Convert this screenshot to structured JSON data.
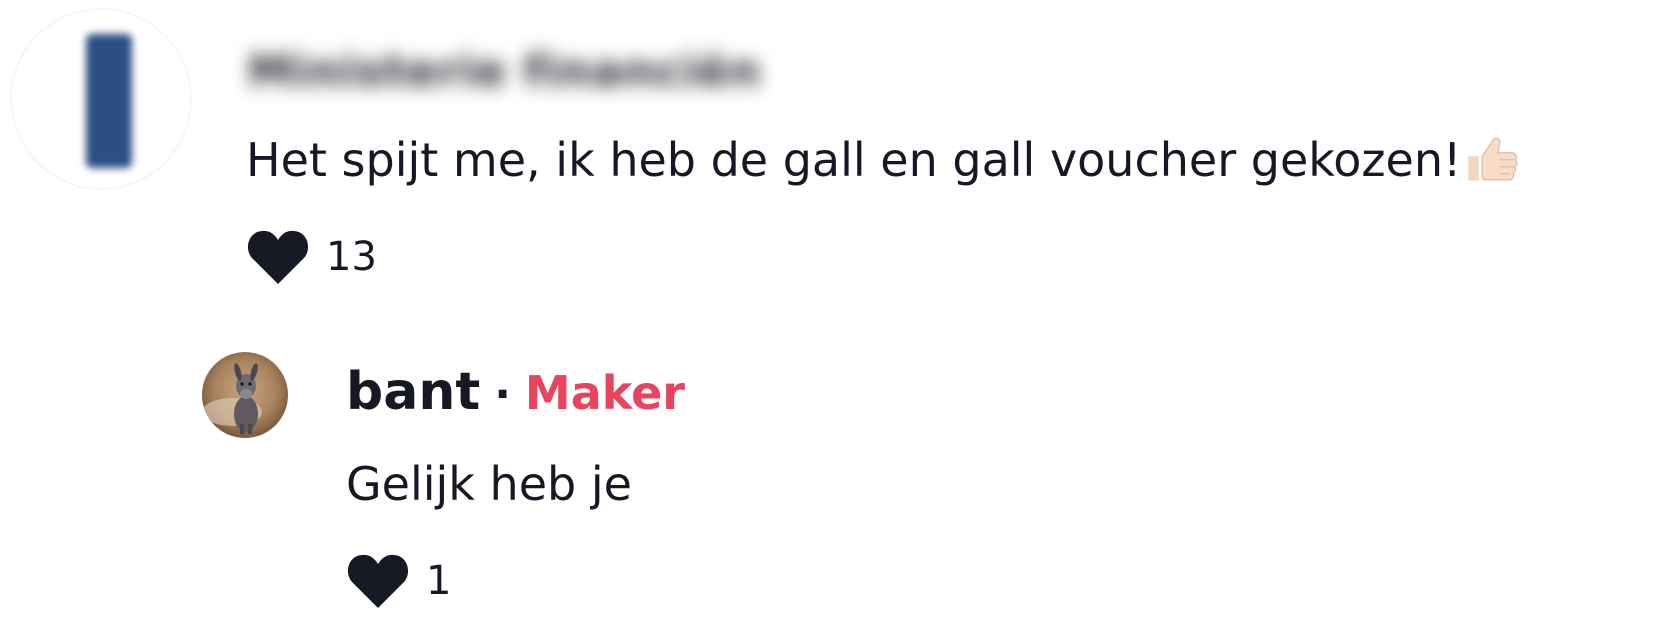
{
  "comment": {
    "username": "Ministerie financiën",
    "text": "Het spijt me, ik heb de gall en gall voucher gekozen!",
    "emoji_icon": "thumbs-up-icon",
    "like_icon": "heart-icon",
    "likes": "13"
  },
  "reply": {
    "username": "bant",
    "separator": "·",
    "badge": "Maker",
    "text": "Gelijk heb je",
    "like_icon": "heart-icon",
    "likes": "1"
  },
  "colors": {
    "text": "#161823",
    "creator_badge": "#e8445e",
    "avatar_blue": "#2b4f83"
  }
}
